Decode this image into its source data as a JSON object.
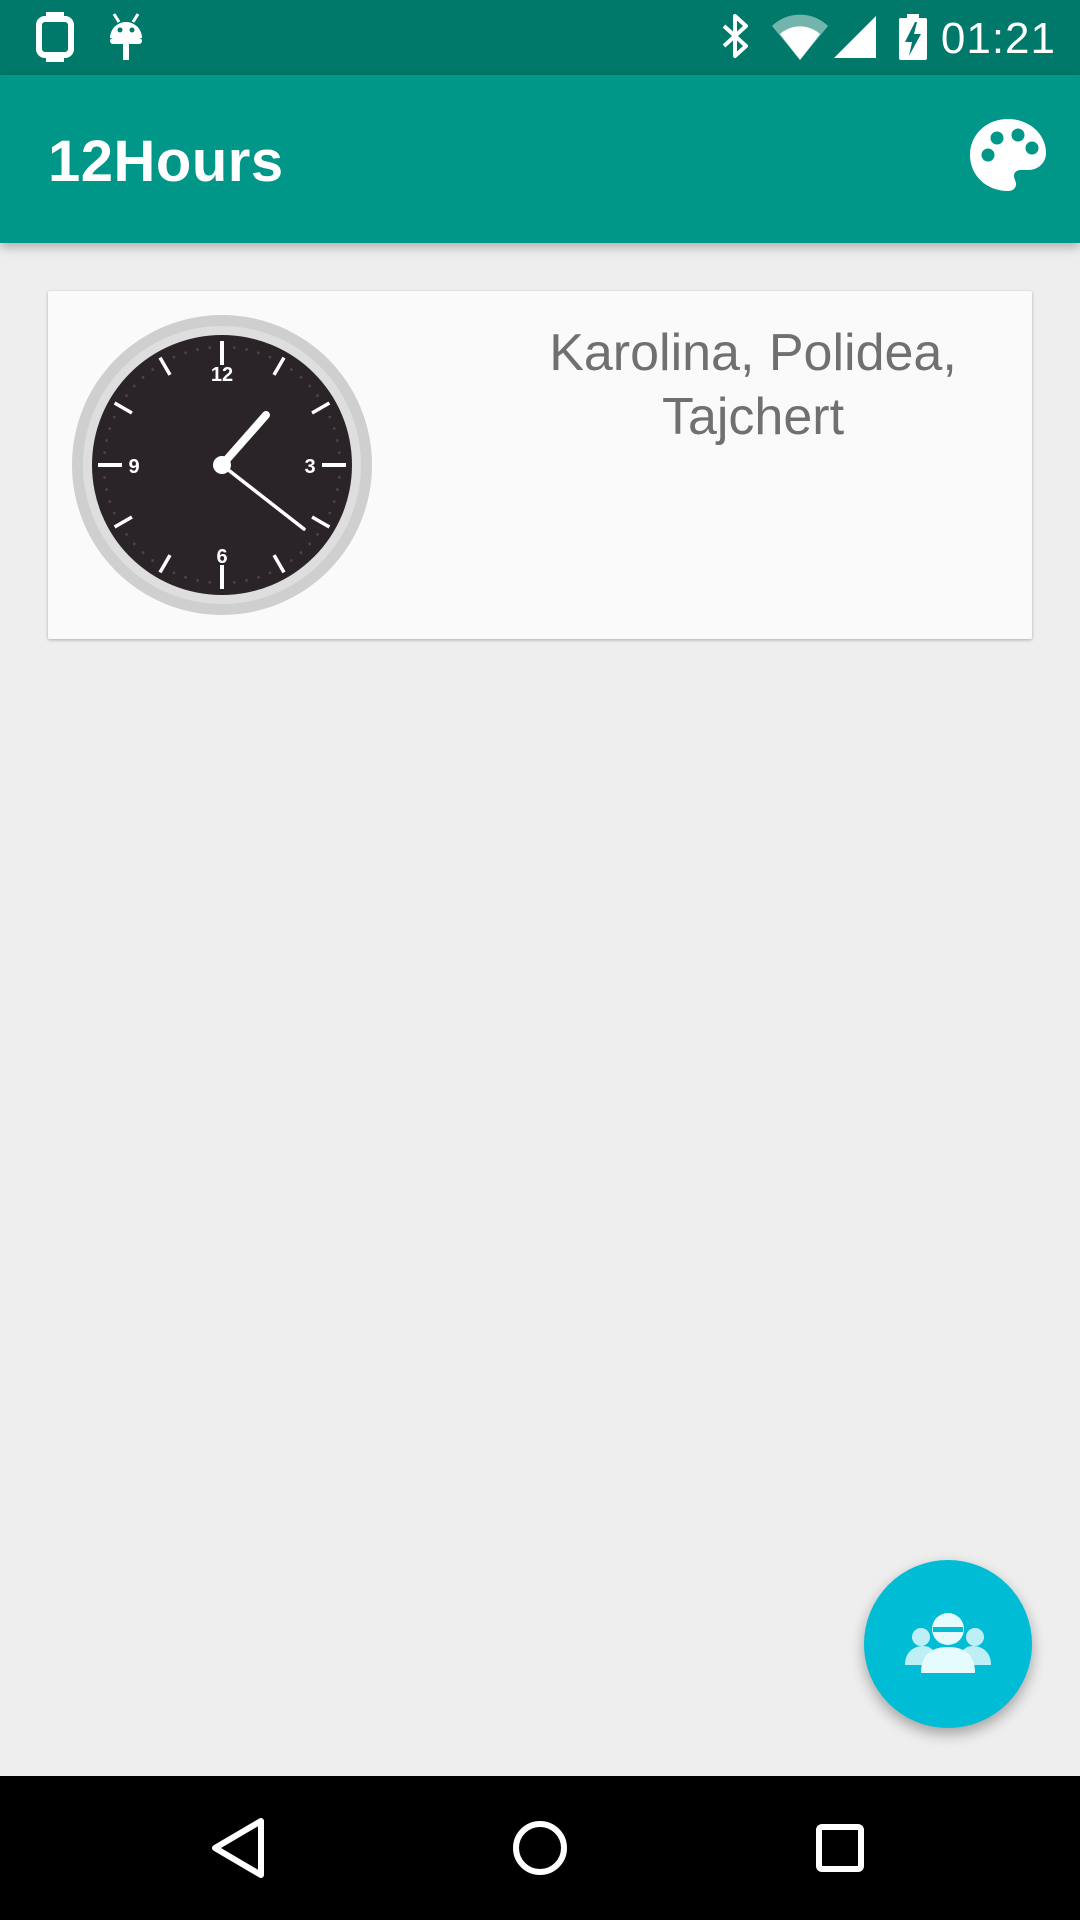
{
  "status_bar": {
    "time": "01:21",
    "icons": [
      "watch-icon",
      "android-icon",
      "bluetooth-icon",
      "wifi-icon",
      "signal-icon",
      "battery-charging-icon"
    ]
  },
  "app_bar": {
    "title": "12Hours",
    "action_icon": "palette-icon"
  },
  "card": {
    "label": "Karolina, Polidea, Tajchert",
    "clock": {
      "numerals": [
        "12",
        "3",
        "6",
        "9"
      ],
      "time_shown": "1:21"
    }
  },
  "fab": {
    "icon": "group-icon"
  },
  "nav_bar": {
    "icons": [
      "back-icon",
      "home-icon",
      "recents-icon"
    ]
  },
  "colors": {
    "status_bar": "#00796b",
    "app_bar": "#009688",
    "fab": "#00bcd4",
    "background": "#eeeeee",
    "card": "#fafafa"
  }
}
